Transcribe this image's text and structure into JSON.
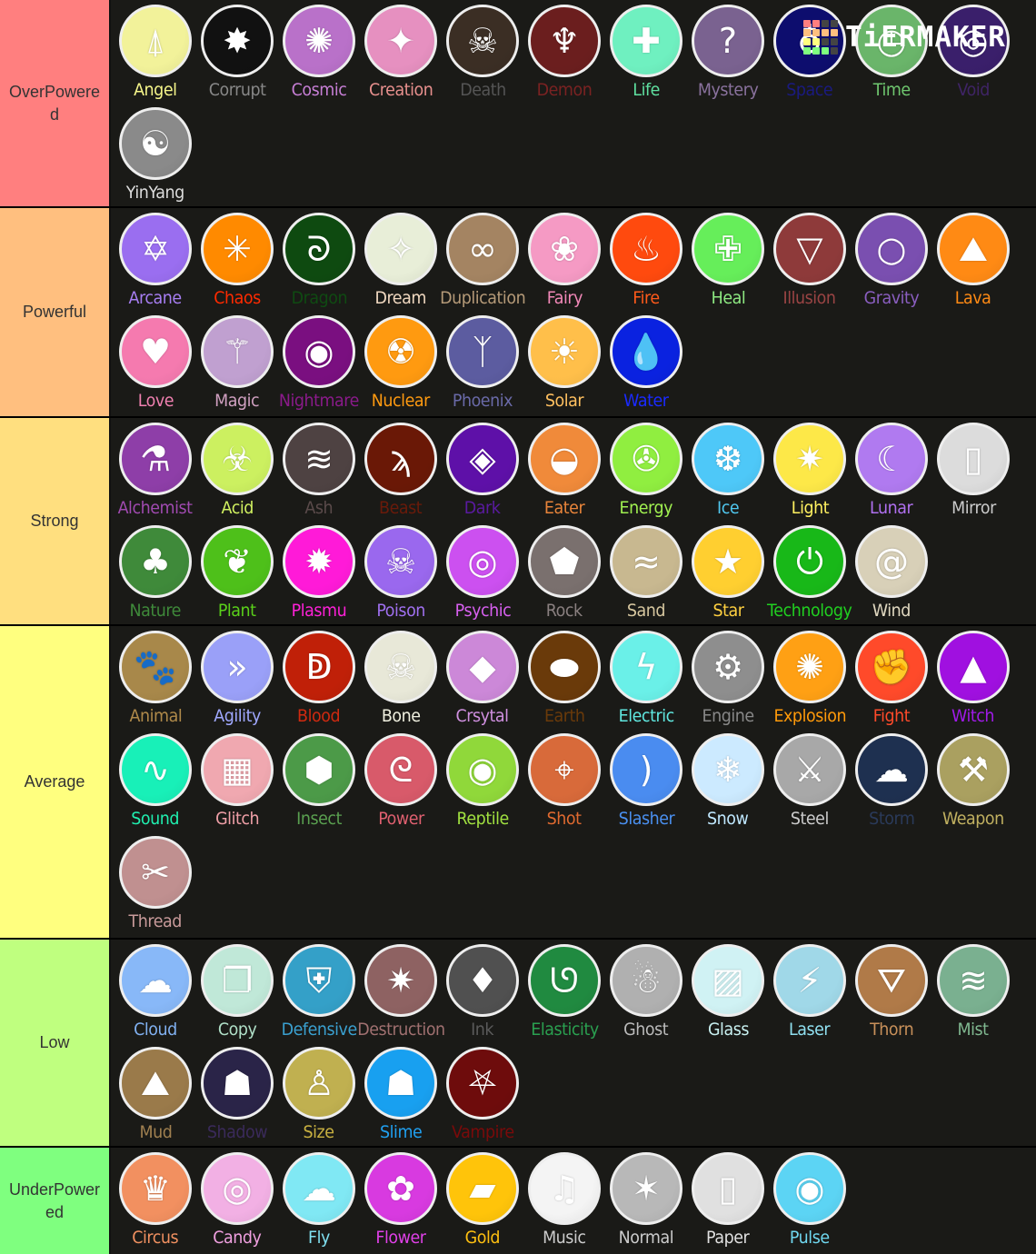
{
  "logo": {
    "text": "TiERMAKER",
    "grid_colors": [
      "#ff7f7f",
      "#ff7f7f",
      "#444444",
      "#444444",
      "#ffbf7f",
      "#ffbf7f",
      "#ffbf7f",
      "#ffbf7f",
      "#ffff7f",
      "#ffff7f",
      "#444444",
      "#444444",
      "#7fff7f",
      "#7fff7f",
      "#7fff7f",
      "#444444"
    ]
  },
  "tiers": [
    {
      "label": "OverPowered",
      "color": "#ff7f7f",
      "items": [
        {
          "name": "Angel",
          "color": "#f5f58a",
          "bg": "#f2f29a",
          "icon": "angel-wings-icon",
          "glyph": "⍋"
        },
        {
          "name": "Corrupt",
          "color": "#888888",
          "bg": "#111111",
          "icon": "corrupt-splat-icon",
          "glyph": "✸"
        },
        {
          "name": "Cosmic",
          "color": "#c77fd6",
          "bg": "#b971c9",
          "icon": "galaxy-icon",
          "glyph": "✺"
        },
        {
          "name": "Creation",
          "color": "#e8908e",
          "bg": "#e690c0",
          "icon": "creation-spark-icon",
          "glyph": "✦"
        },
        {
          "name": "Death",
          "color": "#555555",
          "bg": "#3b2e24",
          "icon": "skull-icon",
          "glyph": "☠"
        },
        {
          "name": "Demon",
          "color": "#7a2222",
          "bg": "#6b1e1e",
          "icon": "demon-wings-icon",
          "glyph": "♆"
        },
        {
          "name": "Life",
          "color": "#5fe0a0",
          "bg": "#6ff0c0",
          "icon": "life-cross-icon",
          "glyph": "✚"
        },
        {
          "name": "Mystery",
          "color": "#8a729e",
          "bg": "#7a6290",
          "icon": "question-mark-icon",
          "glyph": "?"
        },
        {
          "name": "Space",
          "color": "#1a1a80",
          "bg": "#0d0d6e",
          "icon": "planet-icon",
          "glyph": "♁"
        },
        {
          "name": "Time",
          "color": "#6fc76f",
          "bg": "#6ab56a",
          "icon": "clock-icon",
          "glyph": "◷"
        },
        {
          "name": "Void",
          "color": "#3f2466",
          "bg": "#3a1f6b",
          "icon": "void-portal-icon",
          "glyph": "◎"
        },
        {
          "name": "YinYang",
          "color": "#dddddd",
          "bg": "#8a8a8a",
          "icon": "yin-yang-icon",
          "glyph": "☯"
        }
      ]
    },
    {
      "label": "Powerful",
      "color": "#ffbf7f",
      "items": [
        {
          "name": "Arcane",
          "color": "#a77ef2",
          "bg": "#9a6ef0",
          "icon": "hexagram-icon",
          "glyph": "✡"
        },
        {
          "name": "Chaos",
          "color": "#ff2a00",
          "bg": "#ff8a00",
          "icon": "chaos-star-icon",
          "glyph": "✳"
        },
        {
          "name": "Dragon",
          "color": "#0f4a12",
          "bg": "#0e4a10",
          "icon": "dragon-icon",
          "glyph": "ᘐ"
        },
        {
          "name": "Dream",
          "color": "#f0d8c0",
          "bg": "#e8eed8",
          "icon": "dream-star-icon",
          "glyph": "✧"
        },
        {
          "name": "Duplication",
          "color": "#b59a78",
          "bg": "#a48462",
          "icon": "duplication-icon",
          "glyph": "∞"
        },
        {
          "name": "Fairy",
          "color": "#f288b8",
          "bg": "#f59ac4",
          "icon": "fairy-icon",
          "glyph": "❀"
        },
        {
          "name": "Fire",
          "color": "#ff5a1a",
          "bg": "#ff4a0e",
          "icon": "flame-icon",
          "glyph": "♨"
        },
        {
          "name": "Heal",
          "color": "#8eea82",
          "bg": "#66ee5a",
          "icon": "heal-cross-icon",
          "glyph": "✙"
        },
        {
          "name": "Illusion",
          "color": "#9a4444",
          "bg": "#8e3a3a",
          "icon": "penrose-triangle-icon",
          "glyph": "▽"
        },
        {
          "name": "Gravity",
          "color": "#8a5ec0",
          "bg": "#7a4fb0",
          "icon": "gravity-ring-icon",
          "glyph": "○"
        },
        {
          "name": "Lava",
          "color": "#ff8a14",
          "bg": "#ff8a14",
          "icon": "volcano-icon",
          "glyph": "⛰"
        },
        {
          "name": "Love",
          "color": "#f080b0",
          "bg": "#f57aaf",
          "icon": "heart-icon",
          "glyph": "♥"
        },
        {
          "name": "Magic",
          "color": "#d0a0c0",
          "bg": "#c0a0d0",
          "icon": "magic-wand-icon",
          "glyph": "⚚"
        },
        {
          "name": "Nightmare",
          "color": "#8a1a8a",
          "bg": "#7a0f80",
          "icon": "evil-eye-icon",
          "glyph": "◉"
        },
        {
          "name": "Nuclear",
          "color": "#ff9a10",
          "bg": "#ff9a10",
          "icon": "radiation-icon",
          "glyph": "☢"
        },
        {
          "name": "Phoenix",
          "color": "#6a6aa8",
          "bg": "#5c5ca0",
          "icon": "phoenix-icon",
          "glyph": "ᛉ"
        },
        {
          "name": "Solar",
          "color": "#ffc060",
          "bg": "#ffbf4a",
          "icon": "sun-icon",
          "glyph": "☀"
        },
        {
          "name": "Water",
          "color": "#1a2aff",
          "bg": "#0a22e0",
          "icon": "water-drop-icon",
          "glyph": "💧"
        }
      ]
    },
    {
      "label": "Strong",
      "color": "#ffdf7f",
      "items": [
        {
          "name": "Alchemist",
          "color": "#a04ab0",
          "bg": "#8e3ea8",
          "icon": "potion-flask-icon",
          "glyph": "⚗"
        },
        {
          "name": "Acid",
          "color": "#d0f060",
          "bg": "#ccf060",
          "icon": "biohazard-icon",
          "glyph": "☣"
        },
        {
          "name": "Ash",
          "color": "#5a4a4a",
          "bg": "#4e4242",
          "icon": "ash-icon",
          "glyph": "≋"
        },
        {
          "name": "Beast",
          "color": "#6a1a0a",
          "bg": "#6a1806",
          "icon": "claw-icon",
          "glyph": "ϡ"
        },
        {
          "name": "Dark",
          "color": "#5a1aa0",
          "bg": "#5e10a8",
          "icon": "spiral-square-icon",
          "glyph": "◈"
        },
        {
          "name": "Eater",
          "color": "#e8843a",
          "bg": "#f08a3a",
          "icon": "eater-mouth-icon",
          "glyph": "◒"
        },
        {
          "name": "Energy",
          "color": "#a0f050",
          "bg": "#90ee40",
          "icon": "energy-triskelion-icon",
          "glyph": "✇"
        },
        {
          "name": "Ice",
          "color": "#50c8f0",
          "bg": "#4ec8f8",
          "icon": "ice-crystal-icon",
          "glyph": "❆"
        },
        {
          "name": "Light",
          "color": "#fff060",
          "bg": "#fde848",
          "icon": "light-star-icon",
          "glyph": "✷"
        },
        {
          "name": "Lunar",
          "color": "#b070f0",
          "bg": "#b07af0",
          "icon": "crescent-moon-icon",
          "glyph": "☾"
        },
        {
          "name": "Mirror",
          "color": "#cccccc",
          "bg": "#dcdcdc",
          "icon": "mirror-icon",
          "glyph": "▯"
        },
        {
          "name": "Nature",
          "color": "#3f8a3a",
          "bg": "#3f8a3a",
          "icon": "tree-icon",
          "glyph": "♣"
        },
        {
          "name": "Plant",
          "color": "#5ad01a",
          "bg": "#4ec01a",
          "icon": "leaf-icon",
          "glyph": "❦"
        },
        {
          "name": "Plasmu",
          "color": "#ff20d8",
          "bg": "#ff1ad8",
          "icon": "plasma-burst-icon",
          "glyph": "✹"
        },
        {
          "name": "Poison",
          "color": "#a070f0",
          "bg": "#9a68ee",
          "icon": "poison-skull-icon",
          "glyph": "☠"
        },
        {
          "name": "Psychic",
          "color": "#d860f0",
          "bg": "#cc50f0",
          "icon": "psychic-eye-icon",
          "glyph": "◎"
        },
        {
          "name": "Rock",
          "color": "#8a8080",
          "bg": "#7a706e",
          "icon": "rock-icon",
          "glyph": "⬟"
        },
        {
          "name": "Sand",
          "color": "#d8c8a0",
          "bg": "#c8b890",
          "icon": "dune-icon",
          "glyph": "≈"
        },
        {
          "name": "Star",
          "color": "#ffd040",
          "bg": "#ffcf30",
          "icon": "star-icon",
          "glyph": "★"
        },
        {
          "name": "Technology",
          "color": "#20d020",
          "bg": "#18b818",
          "icon": "power-button-icon",
          "glyph": "⏻"
        },
        {
          "name": "Wind",
          "color": "#e0d8c0",
          "bg": "#d8d0b8",
          "icon": "wind-swirl-icon",
          "glyph": "@"
        }
      ]
    },
    {
      "label": "Average",
      "color": "#ffff7f",
      "items": [
        {
          "name": "Animal",
          "color": "#b08a4a",
          "bg": "#a8884a",
          "icon": "paw-print-icon",
          "glyph": "🐾"
        },
        {
          "name": "Agility",
          "color": "#a0a8ff",
          "bg": "#9aa0f8",
          "icon": "chevrons-icon",
          "glyph": "»"
        },
        {
          "name": "Blood",
          "color": "#d02a10",
          "bg": "#c02008",
          "icon": "blood-drop-icon",
          "glyph": "ↁ"
        },
        {
          "name": "Bone",
          "color": "#f0f0e0",
          "bg": "#e8e8d8",
          "icon": "bone-icon",
          "glyph": "☠"
        },
        {
          "name": "Crsytal",
          "color": "#d090e0",
          "bg": "#cc88d8",
          "icon": "crystal-icon",
          "glyph": "◆"
        },
        {
          "name": "Earth",
          "color": "#6a3a0a",
          "bg": "#6a3a0a",
          "icon": "earth-rock-icon",
          "glyph": "⬬"
        },
        {
          "name": "Electric",
          "color": "#60e8e0",
          "bg": "#6af0e8",
          "icon": "lightning-icon",
          "glyph": "ϟ"
        },
        {
          "name": "Engine",
          "color": "#888888",
          "bg": "#8e8e8e",
          "icon": "gear-icon",
          "glyph": "⚙"
        },
        {
          "name": "Explosion",
          "color": "#ff9a0a",
          "bg": "#ffa014",
          "icon": "explosion-icon",
          "glyph": "✺"
        },
        {
          "name": "Fight",
          "color": "#ff4a2a",
          "bg": "#ff4a2a",
          "icon": "fist-icon",
          "glyph": "✊"
        },
        {
          "name": "Witch",
          "color": "#a01ae8",
          "bg": "#a010e0",
          "icon": "witch-hat-icon",
          "glyph": "▲"
        },
        {
          "name": "Sound",
          "color": "#20f0b0",
          "bg": "#18f0b8",
          "icon": "sound-wave-icon",
          "glyph": "∿"
        },
        {
          "name": "Glitch",
          "color": "#f0a0a8",
          "bg": "#f0a8b0",
          "icon": "glitch-icon",
          "glyph": "▦"
        },
        {
          "name": "Insect",
          "color": "#5aa050",
          "bg": "#4c9a48",
          "icon": "honeycomb-icon",
          "glyph": "⬢"
        },
        {
          "name": "Power",
          "color": "#e06070",
          "bg": "#d85a6a",
          "icon": "muscle-arm-icon",
          "glyph": "ᘓ"
        },
        {
          "name": "Reptile",
          "color": "#a0e040",
          "bg": "#90d83a",
          "icon": "reptile-eye-icon",
          "glyph": "◉"
        },
        {
          "name": "Shot",
          "color": "#e06a30",
          "bg": "#d86a3a",
          "icon": "crosshair-icon",
          "glyph": "⌖"
        },
        {
          "name": "Slasher",
          "color": "#4a90f0",
          "bg": "#4a8cf0",
          "icon": "slash-marks-icon",
          "glyph": ")"
        },
        {
          "name": "Snow",
          "color": "#c0e8ff",
          "bg": "#cceaff",
          "icon": "snowflake-icon",
          "glyph": "❄"
        },
        {
          "name": "Steel",
          "color": "#cccccc",
          "bg": "#a8a8a8",
          "icon": "steel-blade-icon",
          "glyph": "⚔"
        },
        {
          "name": "Storm",
          "color": "#2a3a5a",
          "bg": "#1e3050",
          "icon": "storm-cloud-icon",
          "glyph": "☁"
        },
        {
          "name": "Weapon",
          "color": "#c0b060",
          "bg": "#aaa060",
          "icon": "hammer-icon",
          "glyph": "⚒"
        },
        {
          "name": "Thread",
          "color": "#c89a9a",
          "bg": "#c09090",
          "icon": "thread-icon",
          "glyph": "✂"
        }
      ]
    },
    {
      "label": "Low",
      "color": "#bfff7f",
      "items": [
        {
          "name": "Cloud",
          "color": "#80b0f0",
          "bg": "#88b8f8",
          "icon": "cloud-icon",
          "glyph": "☁"
        },
        {
          "name": "Copy",
          "color": "#b0e0c8",
          "bg": "#c0e8d8",
          "icon": "copy-cards-icon",
          "glyph": "❐"
        },
        {
          "name": "Defensive",
          "color": "#3aa0d0",
          "bg": "#34a0c8",
          "icon": "shield-icon",
          "glyph": "⛨"
        },
        {
          "name": "Destruction",
          "color": "#a07070",
          "bg": "#8e6262",
          "icon": "destruction-icon",
          "glyph": "✷"
        },
        {
          "name": "Ink",
          "color": "#5a5a5a",
          "bg": "#505050",
          "icon": "ink-splash-icon",
          "glyph": "♦"
        },
        {
          "name": "Elasticity",
          "color": "#2aa050",
          "bg": "#208a40",
          "icon": "elastic-icon",
          "glyph": "ᘎ"
        },
        {
          "name": "Ghost",
          "color": "#bbbbbb",
          "bg": "#b0b0b0",
          "icon": "ghost-icon",
          "glyph": "☃"
        },
        {
          "name": "Glass",
          "color": "#c8f0f0",
          "bg": "#d0f2f4",
          "icon": "glass-pane-icon",
          "glyph": "▨"
        },
        {
          "name": "Laser",
          "color": "#90e0f0",
          "bg": "#a0d8e8",
          "icon": "laser-icon",
          "glyph": "⚡"
        },
        {
          "name": "Thorn",
          "color": "#c8905a",
          "bg": "#b07a48",
          "icon": "thorn-icon",
          "glyph": "⛛"
        },
        {
          "name": "Mist",
          "color": "#80b890",
          "bg": "#7ab090",
          "icon": "mist-icon",
          "glyph": "≋"
        },
        {
          "name": "Mud",
          "color": "#a08050",
          "bg": "#9a7a4a",
          "icon": "mud-icon",
          "glyph": "⛰"
        },
        {
          "name": "Shadow",
          "color": "#3a2a5a",
          "bg": "#2a2448",
          "icon": "hooded-figure-icon",
          "glyph": "☗"
        },
        {
          "name": "Size",
          "color": "#c8b040",
          "bg": "#c0b050",
          "icon": "size-figure-icon",
          "glyph": "♙"
        },
        {
          "name": "Slime",
          "color": "#20a0f0",
          "bg": "#18a0f0",
          "icon": "slime-icon",
          "glyph": "☗"
        },
        {
          "name": "Vampire",
          "color": "#7a0a0a",
          "bg": "#6e0c0c",
          "icon": "bat-icon",
          "glyph": "⛧"
        }
      ]
    },
    {
      "label": "UnderPowered",
      "color": "#7fff7f",
      "items": [
        {
          "name": "Circus",
          "color": "#f09060",
          "bg": "#f29060",
          "icon": "jester-hat-icon",
          "glyph": "♛"
        },
        {
          "name": "Candy",
          "color": "#f0a0e0",
          "bg": "#f2b0e4",
          "icon": "candy-icon",
          "glyph": "◎"
        },
        {
          "name": "Fly",
          "color": "#80e0f0",
          "bg": "#80e8f4",
          "icon": "fly-icon",
          "glyph": "☁"
        },
        {
          "name": "Flower",
          "color": "#e040e8",
          "bg": "#d83ae0",
          "icon": "lily-flower-icon",
          "glyph": "✿"
        },
        {
          "name": "Gold",
          "color": "#ffc010",
          "bg": "#ffc40a",
          "icon": "gold-bar-icon",
          "glyph": "▰"
        },
        {
          "name": "Music",
          "color": "#cccccc",
          "bg": "#f4f4f4",
          "icon": "music-note-icon",
          "glyph": "♫"
        },
        {
          "name": "Normal",
          "color": "#cccccc",
          "bg": "#b8b8b8",
          "icon": "normal-star-icon",
          "glyph": "✶"
        },
        {
          "name": "Paper",
          "color": "#e0e0e0",
          "bg": "#e0e0e0",
          "icon": "paper-icon",
          "glyph": "▯"
        },
        {
          "name": "Pulse",
          "color": "#70d8f0",
          "bg": "#5cd4f4",
          "icon": "pulse-wave-icon",
          "glyph": "◉"
        }
      ]
    }
  ]
}
